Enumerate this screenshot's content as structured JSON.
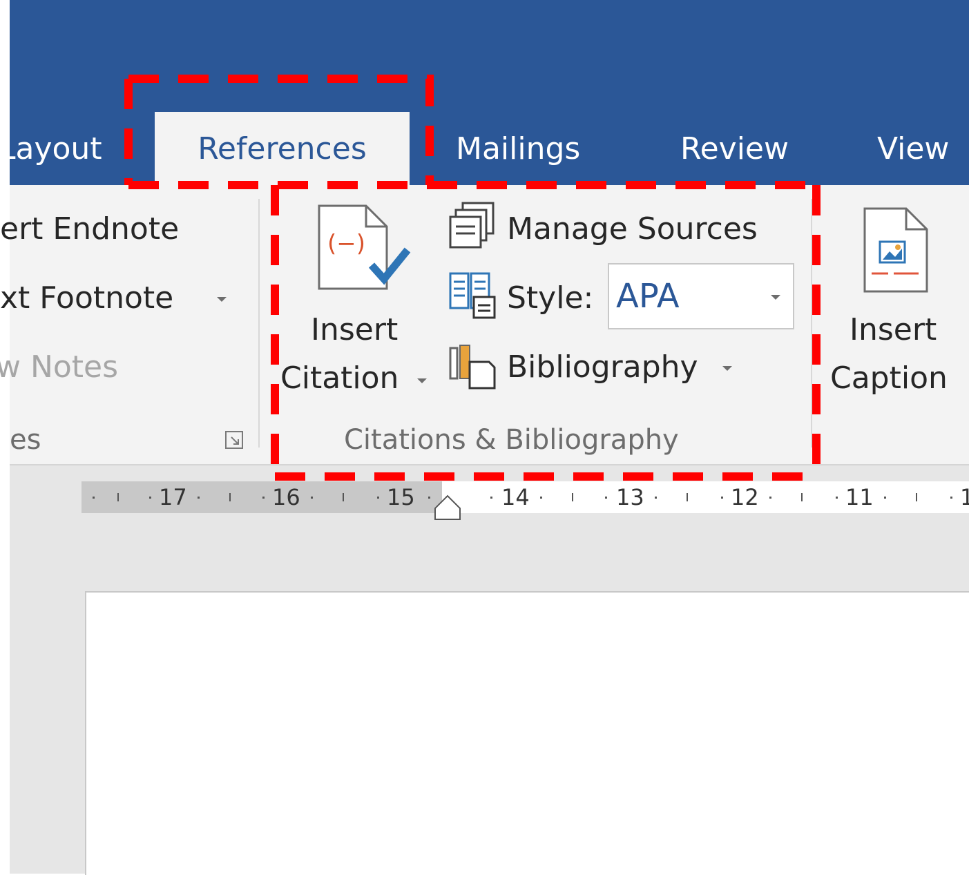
{
  "tabs": {
    "layout": "Layout",
    "references": "References",
    "mailings": "Mailings",
    "review": "Review",
    "view": "View"
  },
  "footnotes_group": {
    "insert_endnote": "ert Endnote",
    "next_footnote": "xt Footnote",
    "show_notes": "w Notes",
    "label": "es"
  },
  "citations_group": {
    "insert_citation_line1": "Insert",
    "insert_citation_line2": "Citation",
    "manage_sources": "Manage Sources",
    "style_label": "Style:",
    "style_value": "APA",
    "bibliography": "Bibliography",
    "label": "Citations & Bibliography"
  },
  "captions_group": {
    "insert_caption_line1": "Insert",
    "insert_caption_line2": "Caption"
  },
  "ruler": {
    "numbers": [
      "17",
      "16",
      "15",
      "14",
      "13",
      "12",
      "11",
      "1"
    ]
  },
  "colors": {
    "title_bar": "#2b5797",
    "ribbon": "#f3f3f3",
    "highlight": "#ff0000"
  }
}
